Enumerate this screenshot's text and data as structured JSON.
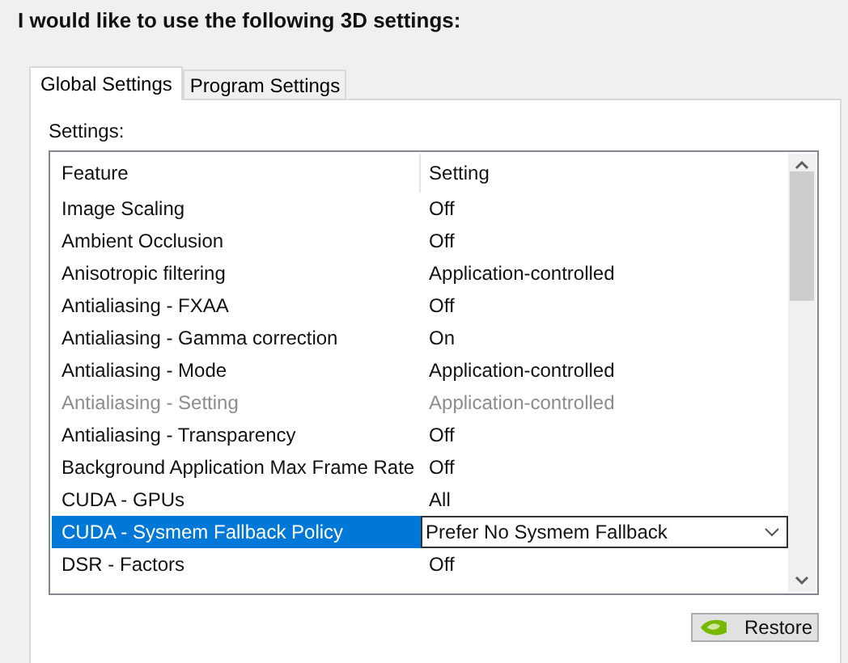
{
  "heading": "I would like to use the following 3D settings:",
  "tabs": [
    {
      "label": "Global Settings",
      "selected": true
    },
    {
      "label": "Program Settings",
      "selected": false
    }
  ],
  "settings_label": "Settings:",
  "table": {
    "columns": [
      "Feature",
      "Setting"
    ],
    "rows": [
      {
        "feature": "Image Scaling",
        "setting": "Off",
        "disabled": false,
        "selected": false
      },
      {
        "feature": "Ambient Occlusion",
        "setting": "Off",
        "disabled": false,
        "selected": false
      },
      {
        "feature": "Anisotropic filtering",
        "setting": "Application-controlled",
        "disabled": false,
        "selected": false
      },
      {
        "feature": "Antialiasing - FXAA",
        "setting": "Off",
        "disabled": false,
        "selected": false
      },
      {
        "feature": "Antialiasing - Gamma correction",
        "setting": "On",
        "disabled": false,
        "selected": false
      },
      {
        "feature": "Antialiasing - Mode",
        "setting": "Application-controlled",
        "disabled": false,
        "selected": false
      },
      {
        "feature": "Antialiasing - Setting",
        "setting": "Application-controlled",
        "disabled": true,
        "selected": false
      },
      {
        "feature": "Antialiasing - Transparency",
        "setting": "Off",
        "disabled": false,
        "selected": false
      },
      {
        "feature": "Background Application Max Frame Rate",
        "setting": "Off",
        "disabled": false,
        "selected": false
      },
      {
        "feature": "CUDA - GPUs",
        "setting": "All",
        "disabled": false,
        "selected": false
      },
      {
        "feature": "CUDA - Sysmem Fallback Policy",
        "setting": "Prefer No Sysmem Fallback",
        "disabled": false,
        "selected": true
      },
      {
        "feature": "DSR - Factors",
        "setting": "Off",
        "disabled": false,
        "selected": false
      }
    ]
  },
  "restore_button": "Restore"
}
